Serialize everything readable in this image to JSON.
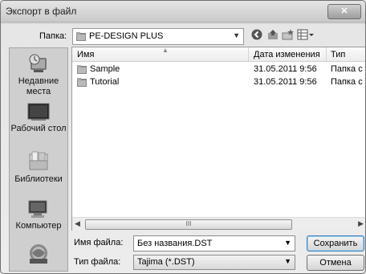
{
  "window": {
    "title": "Экспорт в файл",
    "close_label": "✕"
  },
  "lookin": {
    "label": "Папка:",
    "value": "PE-DESIGN PLUS",
    "dropdown_arrow": "▼"
  },
  "toolbar": {
    "back_icon": "back-icon",
    "up_icon": "up-folder-icon",
    "new_folder_icon": "new-folder-icon",
    "views_icon": "view-menu-icon"
  },
  "places": [
    {
      "label": "Недавние места",
      "icon": "recent-places-icon"
    },
    {
      "label": "Рабочий стол",
      "icon": "desktop-icon"
    },
    {
      "label": "Библиотеки",
      "icon": "libraries-icon"
    },
    {
      "label": "Компьютер",
      "icon": "computer-icon"
    },
    {
      "label": "",
      "icon": "network-icon"
    }
  ],
  "columns": [
    "Имя",
    "Дата изменения",
    "Тип"
  ],
  "files": [
    {
      "name": "Sample",
      "date": "31.05.2011 9:56",
      "type": "Папка с ф"
    },
    {
      "name": "Tutorial",
      "date": "31.05.2011 9:56",
      "type": "Папка с ф"
    }
  ],
  "scrollbar": {
    "grip": "III"
  },
  "filename": {
    "label": "Имя файла:",
    "value": "Без названия.DST"
  },
  "filetype": {
    "label": "Тип файла:",
    "value": "Tajima (*.DST)"
  },
  "buttons": {
    "save": "Сохранить",
    "cancel": "Отмена"
  },
  "colors": {
    "titlebar": "#c9c9c9",
    "primary_button_border": "#3c7fb1"
  }
}
